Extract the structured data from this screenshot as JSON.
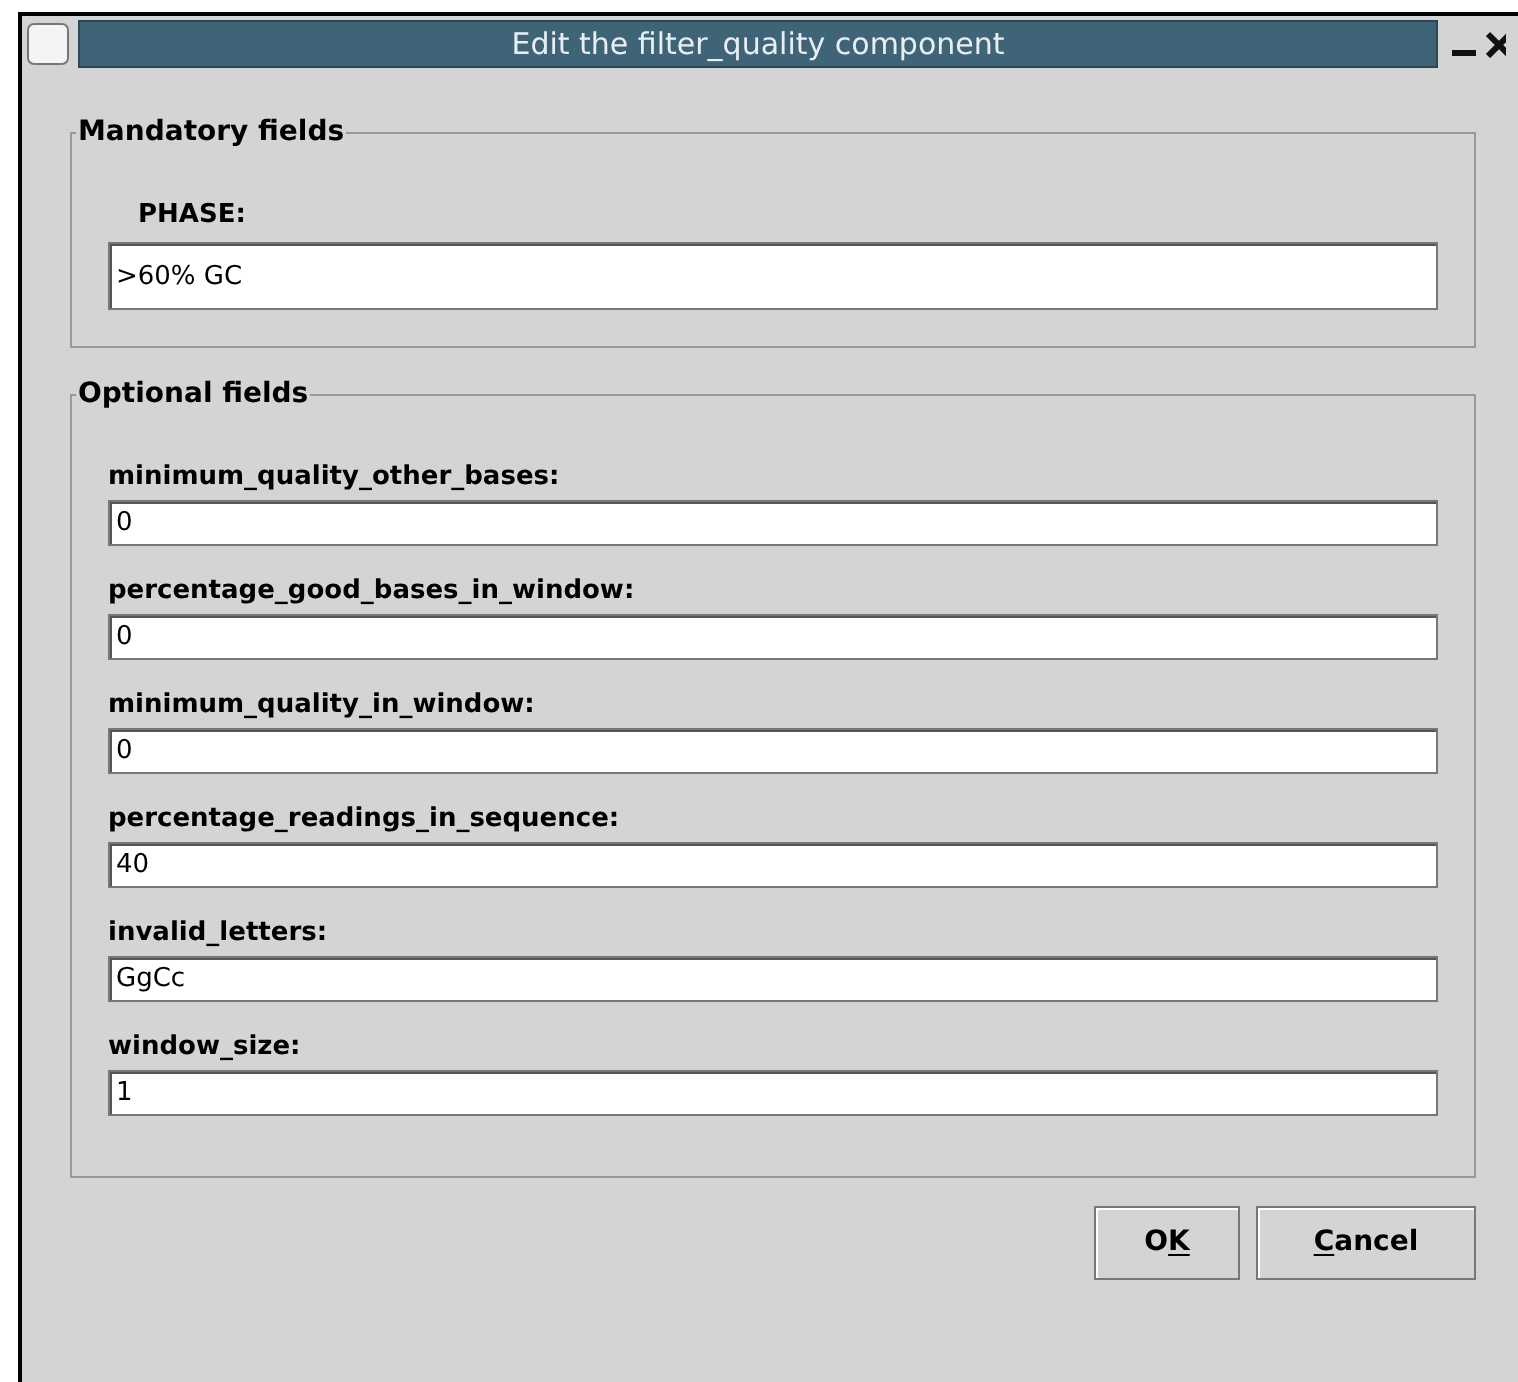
{
  "window": {
    "title": "Edit the filter_quality component"
  },
  "mandatory": {
    "legend": "Mandatory fields",
    "fields": [
      {
        "label": "PHASE:",
        "value": ">60% GC"
      }
    ]
  },
  "optional": {
    "legend": "Optional fields",
    "fields": [
      {
        "label": "minimum_quality_other_bases:",
        "value": "0"
      },
      {
        "label": "percentage_good_bases_in_window:",
        "value": "0"
      },
      {
        "label": "minimum_quality_in_window:",
        "value": "0"
      },
      {
        "label": "percentage_readings_in_sequence:",
        "value": "40"
      },
      {
        "label": "invalid_letters:",
        "value": "GgCc"
      },
      {
        "label": "window_size:",
        "value": "1"
      }
    ]
  },
  "buttons": [
    {
      "before": "O",
      "mnemonic": "K"
    },
    {
      "mnemonic": "C",
      "after": "ancel"
    }
  ]
}
